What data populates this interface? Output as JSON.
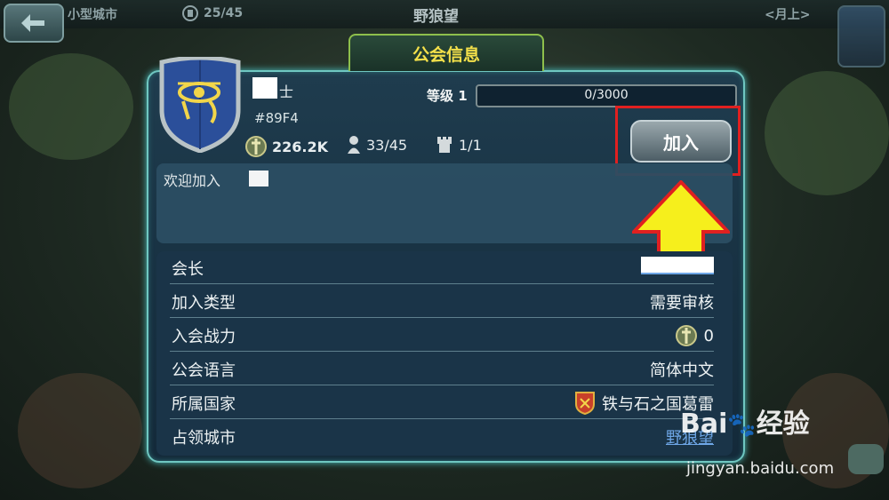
{
  "topbar": {
    "city_label": "小型城市",
    "count": "25/45",
    "center_title": "野狼望",
    "right_label": "<月上>"
  },
  "dialog": {
    "title": "公会信息",
    "guild_name_visible": "士",
    "guild_tag": "#89F4",
    "level_label": "等级 1",
    "level_progress_text": "0/3000",
    "level_progress": 0,
    "power": "226.2K",
    "members": "33/45",
    "castles": "1/1",
    "join_label": "加入",
    "welcome_text": "欢迎加入"
  },
  "info_rows": [
    {
      "label": "会长",
      "value": "",
      "type": "blurred-link"
    },
    {
      "label": "加入类型",
      "value": "需要审核",
      "type": "text"
    },
    {
      "label": "入会战力",
      "value": "0",
      "type": "power"
    },
    {
      "label": "公会语言",
      "value": "简体中文",
      "type": "text"
    },
    {
      "label": "所属国家",
      "value": "铁与石之国葛雷",
      "type": "flag"
    },
    {
      "label": "占领城市",
      "value": "野狼望",
      "type": "link"
    }
  ],
  "watermark": {
    "brand": "Bai",
    "brand2": "经验",
    "url": "jingyan.baidu.com"
  },
  "colors": {
    "accent_yellow": "#f3e04a",
    "dialog_border": "#6fc7c1",
    "highlight_red": "#e02020",
    "arrow_yellow": "#f6ef1c"
  },
  "icons": [
    "back-arrow-icon",
    "castle-count-icon",
    "eye-of-horus-crest",
    "power-sword-icon",
    "member-icon",
    "tower-icon",
    "country-flag-icon",
    "chat-icon",
    "arrow-up-annotation"
  ]
}
